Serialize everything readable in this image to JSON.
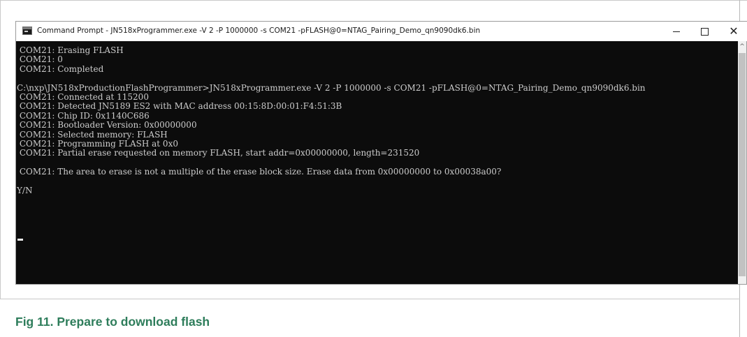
{
  "window": {
    "title": "Command Prompt - JN518xProgrammer.exe  -V 2 -P 1000000 -s COM21 -pFLASH@0=NTAG_Pairing_Demo_qn9090dk6.bin",
    "controls": {
      "minimize_icon": "minimize-icon",
      "maximize_icon": "maximize-icon",
      "close_glyph": "✕"
    }
  },
  "console": {
    "background": "#0c0c0c",
    "text_color": "#cccccc",
    "lines": [
      " COM21: Erasing FLASH",
      " COM21: 0",
      " COM21: Completed",
      "",
      "C:\\nxp\\JN518xProductionFlashProgrammer>JN518xProgrammer.exe -V 2 -P 1000000 -s COM21 -pFLASH@0=NTAG_Pairing_Demo_qn9090dk6.bin",
      " COM21: Connected at 115200",
      " COM21: Detected JN5189 ES2 with MAC address 00:15:8D:00:01:F4:51:3B",
      " COM21: Chip ID: 0x1140C686",
      " COM21: Bootloader Version: 0x00000000",
      " COM21: Selected memory: FLASH",
      " COM21: Programming FLASH at 0x0",
      " COM21: Partial erase requested on memory FLASH, start addr=0x00000000, length=231520",
      "",
      " COM21: The area to erase is not a multiple of the erase block size. Erase data from 0x00000000 to 0x00038a00?",
      "",
      "Y/N"
    ]
  },
  "caption": {
    "text": "Fig 11. Prepare to download flash",
    "color": "#2e7d5b"
  }
}
